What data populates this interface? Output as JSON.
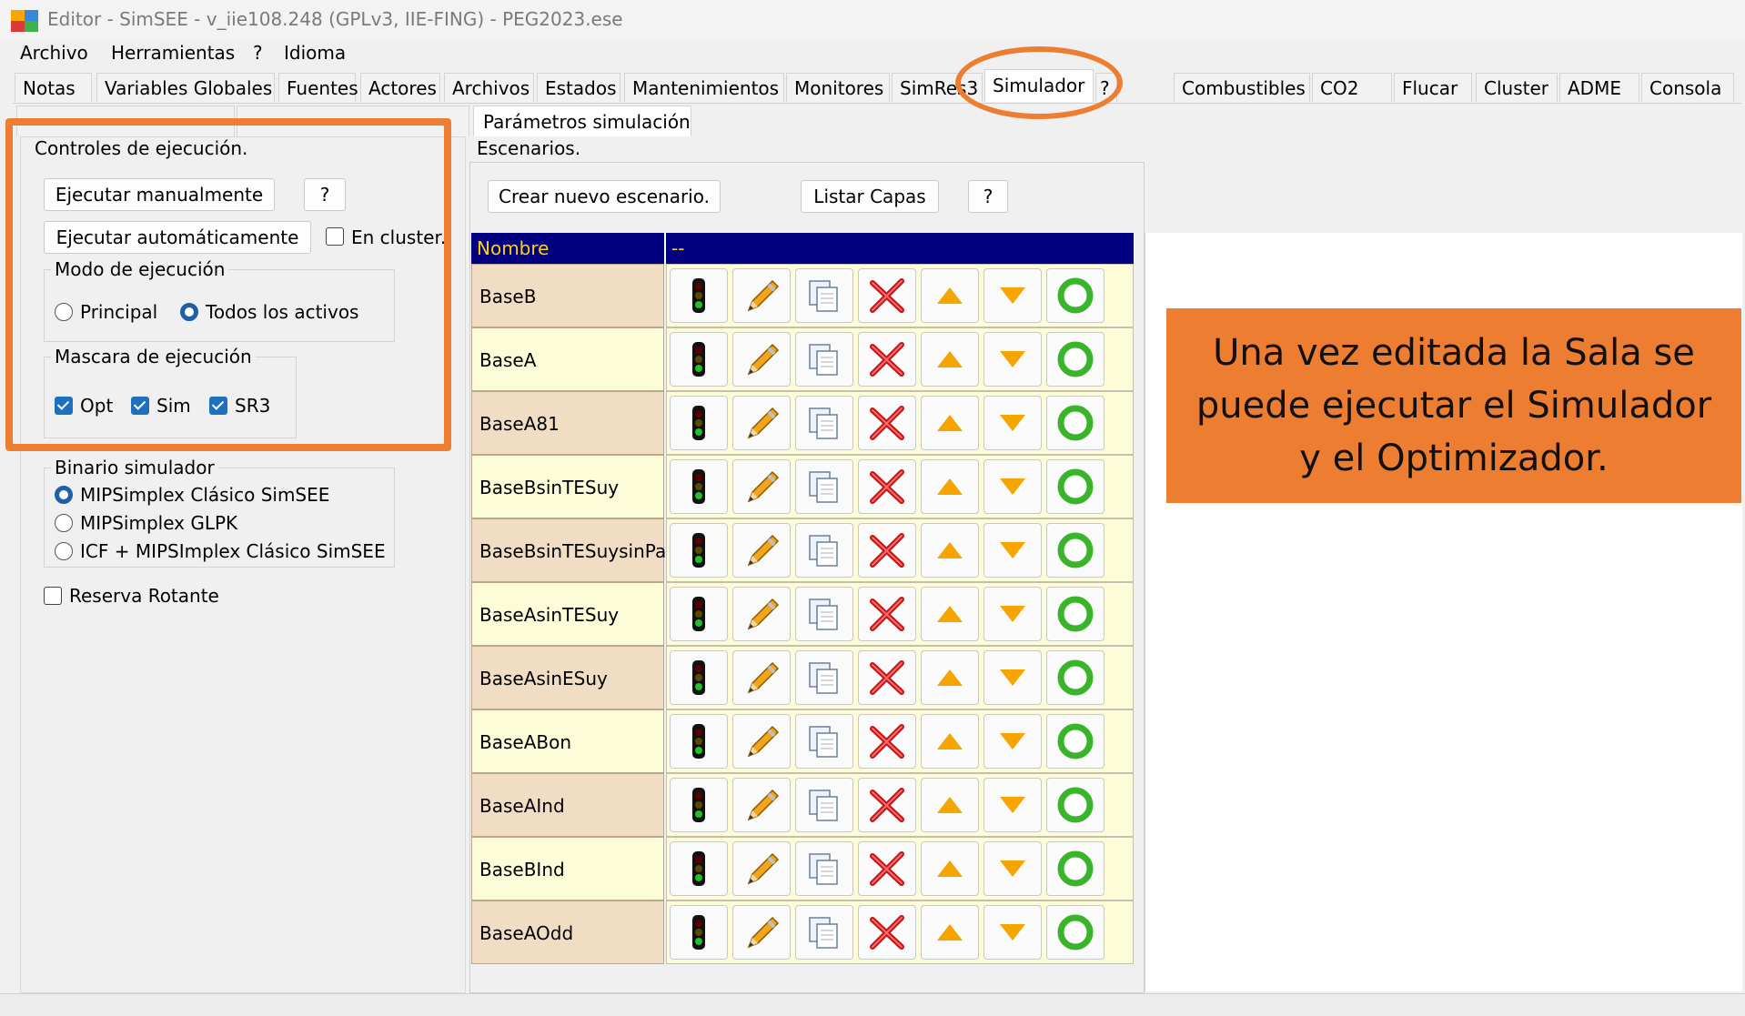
{
  "window": {
    "title": "Editor - SimSEE - v_iie108.248 (GPLv3, IIE-FING) - PEG2023.ese",
    "icon": "simsee-app-icon"
  },
  "menu": [
    "Archivo",
    "Herramientas",
    "?",
    "Idioma"
  ],
  "main_tabs": {
    "items": [
      "Notas",
      "Variables Globales",
      "Fuentes",
      "Actores",
      "Archivos",
      "Estados",
      "Mantenimientos",
      "Monitores",
      "SimRes3",
      "Simulador",
      "?",
      "Combustibles",
      "CO2",
      "Flucar",
      "Cluster",
      "ADME",
      "Consola"
    ],
    "active": "Simulador"
  },
  "sub_tabs": [
    "Parámetros simulación"
  ],
  "left": {
    "controles_title": "Controles de ejecución.",
    "ejecutar_manual": "Ejecutar manualmente",
    "help": "?",
    "ejecutar_auto": "Ejecutar automáticamente",
    "en_cluster": "En cluster.",
    "en_cluster_checked": false,
    "modo_title": "Modo de ejecución",
    "modo_options": [
      "Principal",
      "Todos los activos"
    ],
    "modo_selected": "Todos los activos",
    "mascara_title": "Mascara de ejecución",
    "mascara": [
      {
        "label": "Opt",
        "checked": true
      },
      {
        "label": "Sim",
        "checked": true
      },
      {
        "label": "SR3",
        "checked": true
      }
    ],
    "binario_title": "Binario simulador",
    "binario_options": [
      "MIPSimplex Clásico SimSEE",
      "MIPSimplex GLPK",
      "ICF + MIPSImplex Clásico SimSEE"
    ],
    "binario_selected": "MIPSimplex Clásico SimSEE",
    "reserva": "Reserva Rotante",
    "reserva_checked": false
  },
  "right": {
    "escenarios_title": "Escenarios.",
    "crear": "Crear nuevo escenario.",
    "listar": "Listar Capas",
    "help": "?",
    "table": {
      "col_name": "Nombre",
      "col_actions": "--",
      "rows": [
        "BaseB",
        "BaseA",
        "BaseA81",
        "BaseBsinTESuy",
        "BaseBsinTESuysinPal",
        "BaseAsinTESuy",
        "BaseAsinESuy",
        "BaseABon",
        "BaseAInd",
        "BaseBInd",
        "BaseAOdd"
      ],
      "row_colors": [
        "#f1dcc4",
        "#fcfcd8"
      ],
      "action_icons": [
        "traffic-light-icon",
        "pencil-icon",
        "copy-icon",
        "delete-x-icon",
        "move-up-icon",
        "move-down-icon",
        "active-circle-icon"
      ]
    }
  },
  "callout": "Una vez editada la Sala se puede ejecutar el Simulador y el Optimizador.",
  "colors": {
    "annotation": "#ed7d31",
    "header": "#000080",
    "header_text": "#ffd200",
    "accent": "#1f6fbf"
  }
}
